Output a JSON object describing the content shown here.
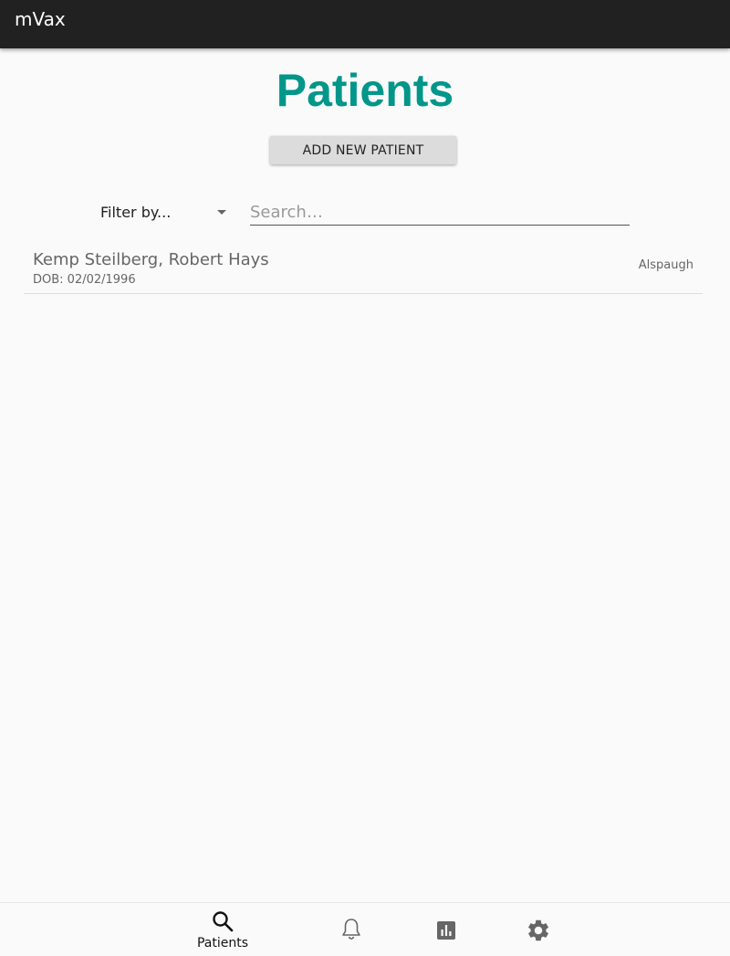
{
  "app": {
    "title": "mVax"
  },
  "page": {
    "title": "Patients"
  },
  "actions": {
    "add_patient_label": "ADD NEW PATIENT"
  },
  "filter": {
    "label": "Filter by...",
    "icon": "dropdown-caret-icon"
  },
  "search": {
    "placeholder": "Search…",
    "value": ""
  },
  "patients": [
    {
      "name": "Kemp Steilberg, Robert Hays",
      "dob": "DOB: 02/02/1996",
      "meta": "Alspaugh"
    }
  ],
  "bottom_nav": [
    {
      "label": "Patients",
      "icon": "search-icon",
      "active": true
    },
    {
      "label": "",
      "icon": "bell-icon",
      "active": false
    },
    {
      "label": "",
      "icon": "chart-icon",
      "active": false
    },
    {
      "label": "",
      "icon": "gear-icon",
      "active": false
    }
  ],
  "colors": {
    "accent": "#00968a",
    "appbar": "#212121"
  }
}
